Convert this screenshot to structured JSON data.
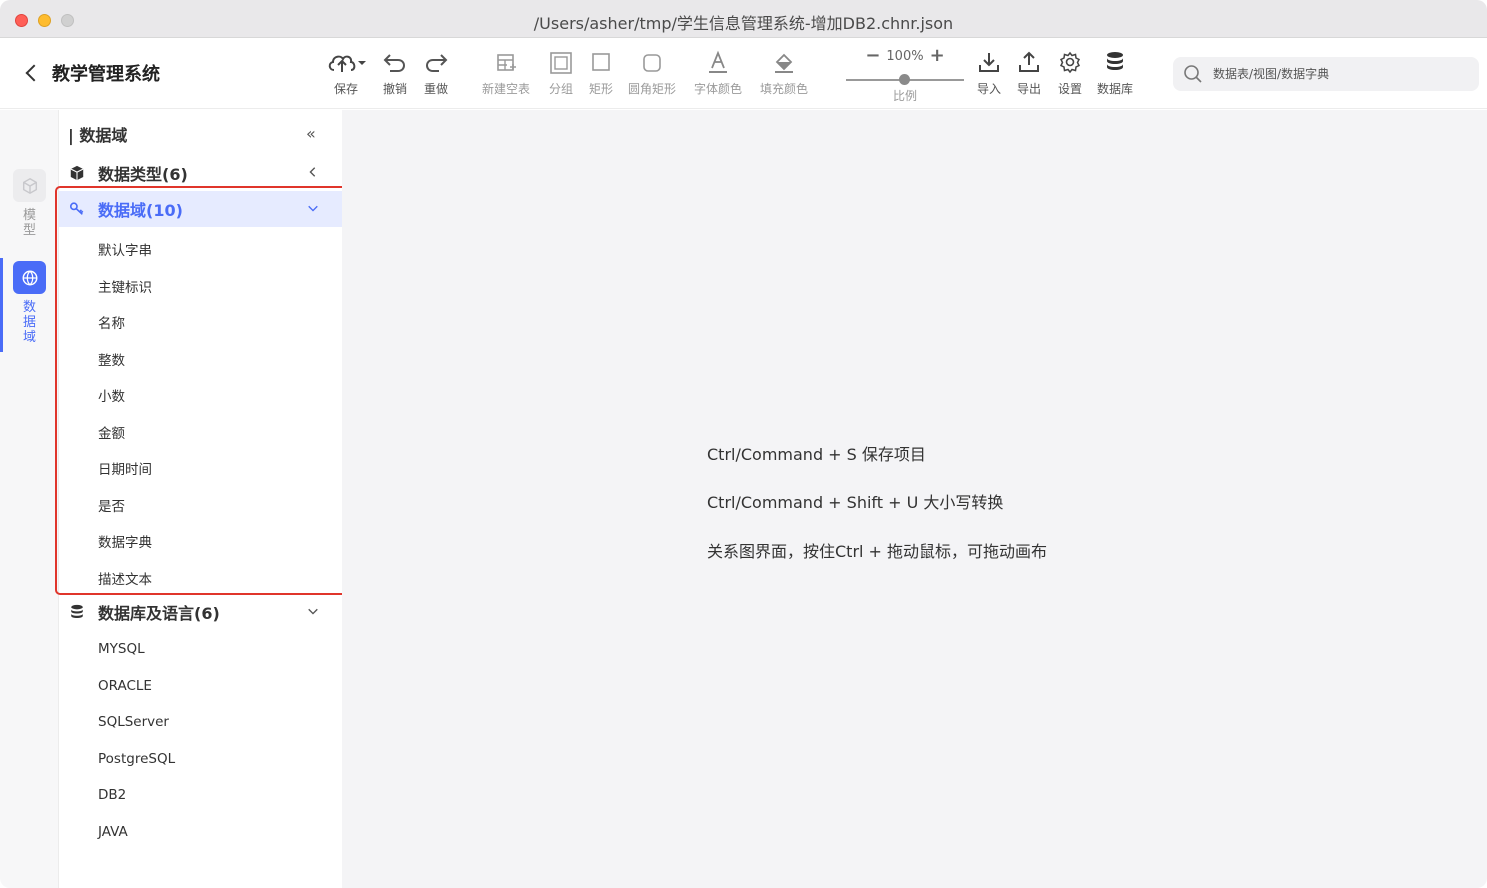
{
  "window": {
    "title": "/Users/asher/tmp/学生信息管理系统-增加DB2.chnr.json"
  },
  "toolbar": {
    "back_title": "教学管理系统",
    "save": "保存",
    "undo": "撤销",
    "redo": "重做",
    "new_table": "新建空表",
    "group": "分组",
    "rect": "矩形",
    "round_rect": "圆角矩形",
    "font_color": "字体颜色",
    "fill_color": "填充颜色",
    "zoom_minus": "−",
    "zoom_value": "100%",
    "zoom_plus": "+",
    "zoom_label": "比例",
    "import": "导入",
    "export": "导出",
    "settings": "设置",
    "database": "数据库",
    "search_placeholder": "数据表/视图/数据字典"
  },
  "rail": {
    "model": "模型",
    "domain": "数据域"
  },
  "panel": {
    "header": "| 数据域",
    "collapse_icon": "«",
    "groups": [
      {
        "title": "数据类型(6)",
        "icon": "cube-icon",
        "arrow": "chevron-left-icon"
      },
      {
        "title": "数据域(10)",
        "icon": "key-icon",
        "arrow": "chevron-down-icon"
      },
      {
        "title": "数据库及语言(6)",
        "icon": "database-icon",
        "arrow": "chevron-down-icon"
      }
    ],
    "domain_items": [
      "默认字串",
      "主键标识",
      "名称",
      "整数",
      "小数",
      "金额",
      "日期时间",
      "是否",
      "数据字典",
      "描述文本"
    ],
    "db_items": [
      "MYSQL",
      "ORACLE",
      "SQLServer",
      "PostgreSQL",
      "DB2",
      "JAVA"
    ]
  },
  "canvas": {
    "hints": [
      "Ctrl/Command + S 保存项目",
      "Ctrl/Command + Shift + U 大小写转换",
      "关系图界面，按住Ctrl + 拖动鼠标，可拖动画布"
    ]
  },
  "colors": {
    "accent": "#4a6cf7",
    "highlight": "#e0352b",
    "canvas_bg": "#f4f4f6"
  }
}
